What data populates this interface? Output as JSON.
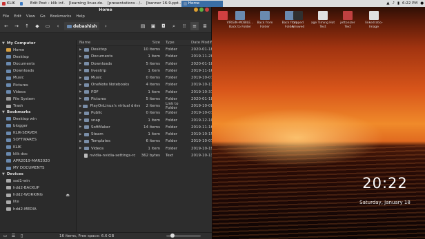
{
  "taskbar": {
    "start_label": "KLIK",
    "items": [
      {
        "label": "",
        "active": false
      },
      {
        "label": "Edit Post ‹ klik inf...",
        "active": false
      },
      {
        "label": "[learning linux.do...",
        "active": false
      },
      {
        "label": "[presentations - /...",
        "active": false
      },
      {
        "label": "[banner 16-9.ppt...",
        "active": false
      },
      {
        "label": "Home",
        "active": true
      }
    ],
    "time": "6:22 PM"
  },
  "window": {
    "title": "Home",
    "menu": [
      "File",
      "Edit",
      "View",
      "Go",
      "Bookmarks",
      "Help"
    ],
    "path_segment": "debashish"
  },
  "sidebar": {
    "sections": [
      {
        "title": "My Computer",
        "items": [
          {
            "label": "Home",
            "color": "#d8a040"
          },
          {
            "label": "Desktop",
            "color": "#6a8ab0"
          },
          {
            "label": "Documents",
            "color": "#6a8ab0"
          },
          {
            "label": "Downloads",
            "color": "#6a8ab0"
          },
          {
            "label": "Music",
            "color": "#6a8ab0"
          },
          {
            "label": "Pictures",
            "color": "#6a8ab0"
          },
          {
            "label": "Videos",
            "color": "#6a8ab0"
          },
          {
            "label": "File System",
            "color": "#999999"
          },
          {
            "label": "Trash",
            "color": "#aaaaaa"
          }
        ]
      },
      {
        "title": "Bookmarks",
        "items": [
          {
            "label": "Desktop win",
            "color": "#6a8ab0"
          },
          {
            "label": "blogger",
            "color": "#6a8ab0"
          },
          {
            "label": "KLIK-SERVER",
            "color": "#6a8ab0"
          },
          {
            "label": "SOFTWARES",
            "color": "#6a8ab0"
          },
          {
            "label": "KLIK",
            "color": "#6a8ab0"
          },
          {
            "label": "klik doc",
            "color": "#6a8ab0"
          },
          {
            "label": "APR2019-MAR2020",
            "color": "#6a8ab0"
          },
          {
            "label": "MY DOCUMENTS",
            "color": "#6a8ab0"
          }
        ]
      },
      {
        "title": "Devices",
        "items": [
          {
            "label": "ssd1-win",
            "color": "#aaaaaa"
          },
          {
            "label": "hdd2-BACKUP",
            "color": "#aaaaaa"
          },
          {
            "label": "hdd2-WORKING",
            "color": "#aaaaaa",
            "eject": "⏏"
          },
          {
            "label": "lite",
            "color": "#aaaaaa"
          },
          {
            "label": "hdd2-MEDIA",
            "color": "#aaaaaa"
          }
        ]
      }
    ]
  },
  "columns": {
    "name": "Name",
    "size": "Size",
    "type": "Type",
    "date": "Date Modifi"
  },
  "files": [
    {
      "name": "Desktop",
      "size": "10 items",
      "type": "Folder",
      "date": "2020-01-18",
      "file": false
    },
    {
      "name": "Documents",
      "size": "1 item",
      "type": "Folder",
      "date": "2019-11-28",
      "file": false
    },
    {
      "name": "Downloads",
      "size": "5 items",
      "type": "Folder",
      "date": "2020-01-18",
      "file": false
    },
    {
      "name": "livestrip",
      "size": "1 item",
      "type": "Folder",
      "date": "2019-11-16",
      "file": false
    },
    {
      "name": "Music",
      "size": "0 items",
      "type": "Folder",
      "date": "2019-10-07",
      "file": false
    },
    {
      "name": "OneNote Notebooks",
      "size": "4 items",
      "type": "Folder",
      "date": "2019-10-17",
      "file": false
    },
    {
      "name": "PDF",
      "size": "1 item",
      "type": "Folder",
      "date": "2019-10-31",
      "file": false
    },
    {
      "name": "Pictures",
      "size": "5 items",
      "type": "Folder",
      "date": "2020-01-18",
      "file": false
    },
    {
      "name": "PlayOnLinux's virtual drives",
      "size": "2 items",
      "type": "Link to Folder",
      "date": "2019-10-08",
      "file": false
    },
    {
      "name": "Public",
      "size": "0 items",
      "type": "Folder",
      "date": "2019-10-07",
      "file": false
    },
    {
      "name": "snap",
      "size": "1 item",
      "type": "Folder",
      "date": "2019-12-10",
      "file": false
    },
    {
      "name": "SoftMaker",
      "size": "14 items",
      "type": "Folder",
      "date": "2019-11-16",
      "file": false
    },
    {
      "name": "Steam",
      "size": "1 item",
      "type": "Folder",
      "date": "2019-10-15",
      "file": false
    },
    {
      "name": "Templates",
      "size": "6 items",
      "type": "Folder",
      "date": "2019-10-07",
      "file": false
    },
    {
      "name": "Videos",
      "size": "1 item",
      "type": "Folder",
      "date": "2019-10-19",
      "file": false
    },
    {
      "name": "nvidia-nvidia-settings-rc",
      "size": "362 bytes",
      "type": "Text",
      "date": "2019-10-13",
      "file": true
    }
  ],
  "status": "16 items, Free space: 6.6 GB",
  "desktop": {
    "clock": "20:22",
    "date": "Saturday, January 18",
    "icons": [
      {
        "label": "",
        "color": "#d04040"
      },
      {
        "label": "VIRGIN-MOBILE...\nBack to Folder",
        "color": "#6a8ab0"
      },
      {
        "label": "Back from\nFolder",
        "color": "#6a8ab0"
      },
      {
        "label": "Back from\nFolder",
        "color": "#6a8ab0"
      },
      {
        "label": "tapped\nArrowed",
        "color": "#303030"
      },
      {
        "label": "age Timing Hot\nText",
        "color": "#e0e0e0"
      },
      {
        "label": "jettonizer\nText",
        "color": "#c04040"
      },
      {
        "label": "linkedratio-\nImage",
        "color": "#e0e0e0"
      }
    ]
  }
}
